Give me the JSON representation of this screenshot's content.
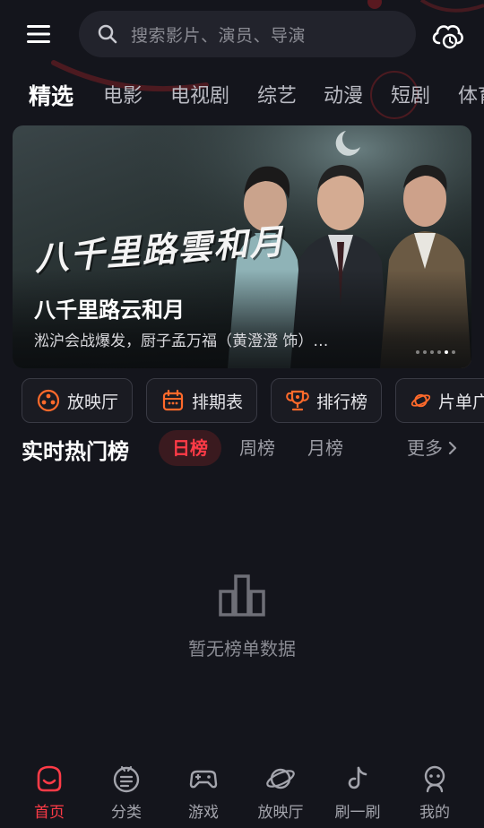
{
  "header": {
    "search_placeholder": "搜索影片、演员、导演"
  },
  "tabs": [
    {
      "label": "精选",
      "active": true
    },
    {
      "label": "电影"
    },
    {
      "label": "电视剧"
    },
    {
      "label": "综艺"
    },
    {
      "label": "动漫"
    },
    {
      "label": "短剧"
    },
    {
      "label": "体育"
    }
  ],
  "banner": {
    "logo_text": "八千里路雲和月",
    "title": "八千里路云和月",
    "subtitle": "淞沪会战爆发，厨子孟万福（黄澄澄 饰）…",
    "slide_count": 6,
    "active_slide": 5
  },
  "quick_entries": [
    {
      "label": "放映厅",
      "icon": "film-reel-icon"
    },
    {
      "label": "排期表",
      "icon": "calendar-icon"
    },
    {
      "label": "排行榜",
      "icon": "trophy-icon"
    },
    {
      "label": "片单广场",
      "icon": "planet-icon"
    }
  ],
  "ranking": {
    "title": "实时热门榜",
    "tabs": [
      {
        "label": "日榜",
        "active": true
      },
      {
        "label": "周榜"
      },
      {
        "label": "月榜"
      }
    ],
    "more_label": "更多",
    "empty_text": "暂无榜单数据"
  },
  "bottom_nav": [
    {
      "label": "首页",
      "icon": "home-icon",
      "active": true
    },
    {
      "label": "分类",
      "icon": "category-icon"
    },
    {
      "label": "游戏",
      "icon": "gamepad-icon"
    },
    {
      "label": "放映厅",
      "icon": "planet-icon"
    },
    {
      "label": "刷一刷",
      "icon": "music-note-icon"
    },
    {
      "label": "我的",
      "icon": "profile-icon"
    }
  ],
  "colors": {
    "background": "#14151c",
    "accent": "#ff3b47",
    "quick_icon": "#ff6a2b",
    "text_muted": "#9a9ba3"
  }
}
